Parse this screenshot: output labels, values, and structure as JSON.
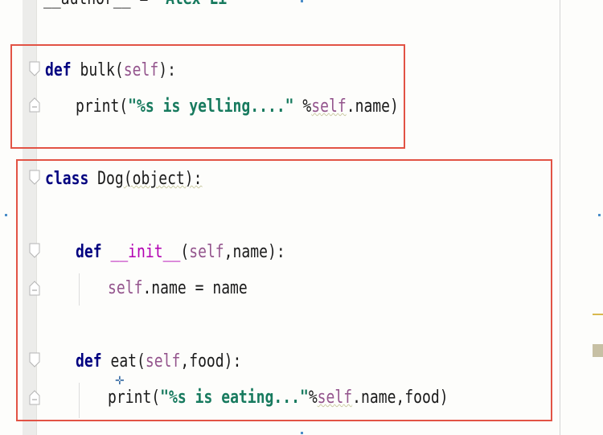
{
  "editor": {
    "lines": {
      "author": {
        "a": "__author__",
        "b": " = ",
        "c": "\"Alex Li\""
      },
      "def_bulk": {
        "kw": "def",
        "name": " bulk",
        "open": "(",
        "self": "self",
        "close": "):"
      },
      "print_bulk": {
        "name": "print",
        "open": "(",
        "str": "\"%s is yelling....\"",
        "space": " ",
        "pct": "%",
        "self": "self",
        "rest": ".name)"
      },
      "class_dog": {
        "kw": "class",
        "name": " Dog",
        "rest": "(object):"
      },
      "def_init": {
        "kw": "def",
        "space": " ",
        "name": "__init__",
        "open": "(",
        "self": "self",
        "rest": ",name):"
      },
      "self_name": {
        "self": "self",
        "rest": ".name = name"
      },
      "def_eat": {
        "kw": "def",
        "name": " eat",
        "open": "(",
        "self": "self",
        "rest": ",food):"
      },
      "print_eat": {
        "name": "print",
        "open": "(",
        "str": "\"%s is eating...\"",
        "pct": "%",
        "self": "self",
        "rest": ".name,food)"
      }
    }
  },
  "colors": {
    "keyword": "#000080",
    "self": "#94558d",
    "string": "#177a5e",
    "magic_method": "#b200b2",
    "highlight_box": "#e25345"
  },
  "icons": [
    "fold-marker-icon",
    "caret-cross-icon"
  ]
}
